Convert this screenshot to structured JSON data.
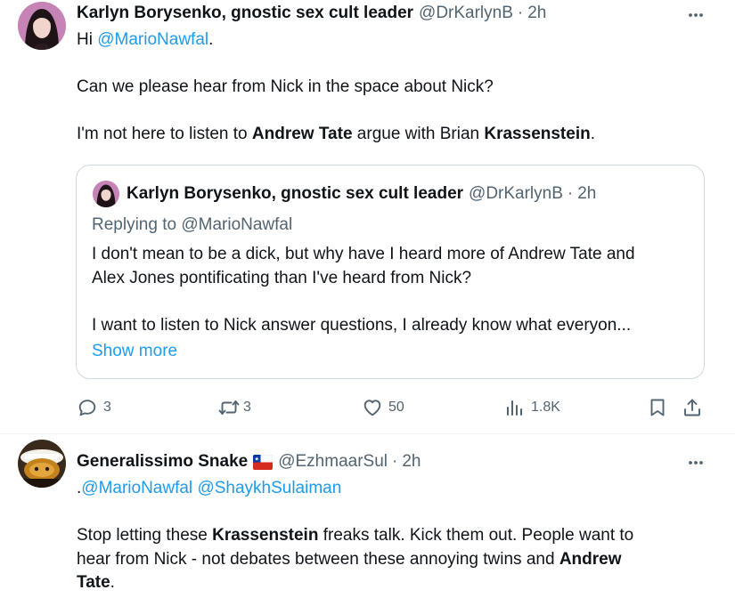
{
  "tweets": [
    {
      "author_name": "Karlyn Borysenko, gnostic sex cult leader",
      "handle": "@DrKarlynB",
      "separator": "·",
      "time": "2h",
      "text": {
        "l1_prefix": "Hi ",
        "l1_mention": "@MarioNawfal",
        "l1_suffix": ".",
        "l2": "Can we please hear from Nick in the space about Nick?",
        "l3_a": "I'm not here to listen to ",
        "l3_b": "Andrew Tate",
        "l3_c": " argue with Brian ",
        "l3_d": "Krassenstein",
        "l3_e": "."
      },
      "quote": {
        "author_name": "Karlyn Borysenko, gnostic sex cult leader",
        "handle": "@DrKarlynB",
        "separator": "·",
        "time": "2h",
        "replying_to": "Replying to @MarioNawfal",
        "line1": "I don't mean to be a dick, but why have I heard more of Andrew Tate and",
        "line2": "Alex Jones pontificating than I've heard from Nick?",
        "line3": "I want to listen to Nick answer questions, I already know what everyon...",
        "show_more": "Show more"
      },
      "actions": {
        "replies": "3",
        "reposts": "3",
        "likes": "50",
        "views": "1.8K"
      },
      "icons": {
        "reply": "reply-icon",
        "repost": "repost-icon",
        "like": "heart-icon",
        "views": "views-icon",
        "bookmark": "bookmark-icon",
        "share": "share-icon",
        "more": "more-icon"
      }
    },
    {
      "author_name": "Generalissimo Snake",
      "flag": "chile-flag",
      "handle": "@EzhmaarSul",
      "separator": "·",
      "time": "2h",
      "text": {
        "l1_prefix": ".",
        "l1_mention_a": "@MarioNawfal",
        "l1_mention_b": "@ShaykhSulaiman",
        "l2_a": "Stop letting these ",
        "l2_b": "Krassenstein",
        "l2_c": " freaks talk. Kick them out. People want to",
        "l3_a": "hear from Nick - not debates between these annoying twins and ",
        "l3_b": "Andrew",
        "l4_a": "Tate",
        "l4_b": "."
      }
    }
  ],
  "colors": {
    "text": "#0f1419",
    "secondary": "#536471",
    "link": "#1d9bf0",
    "border": "#cfd9de",
    "divider": "#eff3f4"
  }
}
